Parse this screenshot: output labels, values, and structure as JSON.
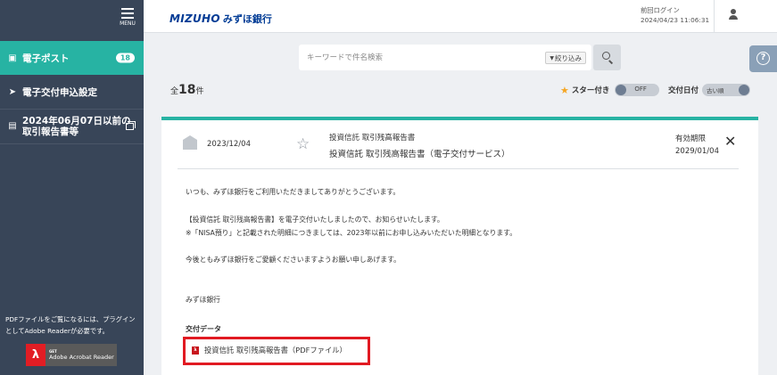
{
  "sidebar": {
    "menu_label": "MENU",
    "items": [
      {
        "label": "電子ポスト",
        "badge": "18"
      },
      {
        "label": "電子交付申込設定"
      },
      {
        "label_line1": "2024年06月07日以前の",
        "label_line2": "取引報告書等"
      }
    ],
    "pdf_note": "PDFファイルをご覧になるには、プラグインとしてAdobe Readerが必要です。",
    "adobe": {
      "get": "GET",
      "name": "Adobe Acrobat Reader"
    }
  },
  "header": {
    "logo_mizuho": "MIZUHO",
    "logo_bank": "みずほ銀行",
    "login_label": "前回ログイン",
    "login_time": "2024/04/23 11:06:31"
  },
  "search": {
    "placeholder": "キーワードで件名検索",
    "filter_label": "絞り込み"
  },
  "list": {
    "count_prefix": "全",
    "count": "18",
    "count_suffix": "件",
    "star_label": "スター付き",
    "star_toggle": "OFF",
    "date_label": "交付日付",
    "date_toggle": "古い順"
  },
  "message": {
    "date": "2023/12/04",
    "category": "投資信託 取引残高報告書",
    "title": "投資信託 取引残高報告書（電子交付サービス）",
    "expiry_label": "有効期限",
    "expiry_date": "2029/01/04",
    "body": [
      "いつも、みずほ銀行をご利用いただきましてありがとうございます。",
      "【投資信託 取引残高報告書】を電子交付いたしましたので、お知らせいたします。",
      "※「NISA預り」と記載された明細につきましては、2023年以前にお申し込みいただいた明細となります。",
      "今後ともみずほ銀行をご愛顧くださいますようお願い申しあげます。",
      "みずほ銀行"
    ],
    "delivery_label": "交付データ",
    "pdf_link": "投資信託 取引残高報告書（PDFファイル）"
  },
  "colors": {
    "sidebar_bg": "#384558",
    "accent_teal": "#27b3a3",
    "brand_blue": "#003b95",
    "highlight_red": "#e11a22",
    "star_orange": "#f5a623"
  }
}
